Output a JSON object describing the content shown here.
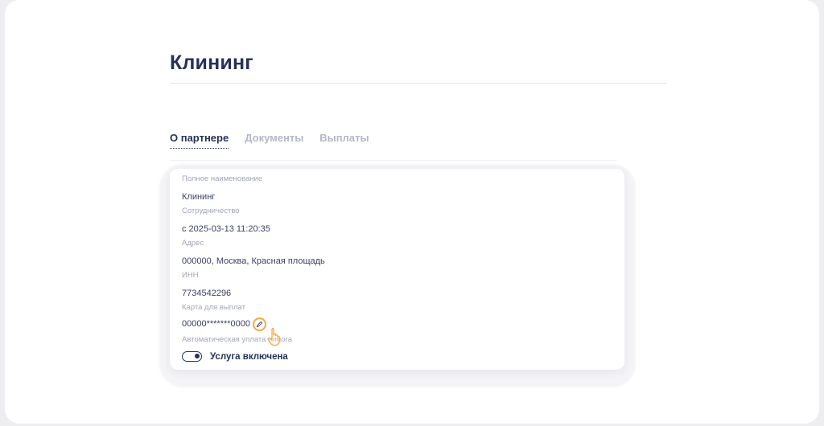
{
  "page": {
    "title": "Клининг"
  },
  "tabs": [
    {
      "label": "О партнере",
      "active": true
    },
    {
      "label": "Документы",
      "active": false
    },
    {
      "label": "Выплаты",
      "active": false
    }
  ],
  "details": {
    "full_name_label": "Полное наименование",
    "full_name_value": "Клининг",
    "cooperation_label": "Сотрудничество",
    "cooperation_value": "с 2025-03-13 11:20:35",
    "address_label": "Адрес",
    "address_value": "000000, Москва, Красная площадь",
    "inn_label": "ИНН",
    "inn_value": "7734542296",
    "card_label": "Карта для выплат",
    "card_value": "00000*******0000",
    "autopay_label": "Автоматическая уплата налога",
    "autopay_value": "Услуга включена",
    "autopay_enabled": true
  },
  "icons": {
    "edit": "pencil-icon",
    "cursor": "hand-pointer-icon"
  },
  "colors": {
    "primary": "#27305a",
    "accent": "#f5a947",
    "muted": "#a1a6b8"
  }
}
